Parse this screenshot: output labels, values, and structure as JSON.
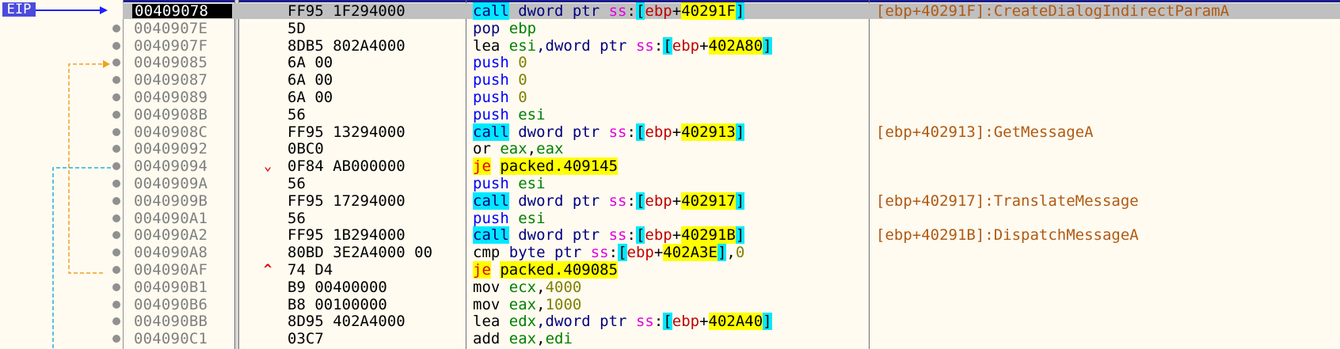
{
  "eip_label": "EIP",
  "rows": [
    {
      "addr": "00409078",
      "bytes": "FF95 1F294000",
      "instr": [
        {
          "t": "call",
          "c": "t-call"
        },
        {
          "t": " dword ptr ",
          "c": "t-kw"
        },
        {
          "t": "ss",
          "c": "t-seg"
        },
        {
          "t": ":",
          "c": ""
        },
        {
          "t": "[",
          "c": "t-br"
        },
        {
          "t": "ebp",
          "c": "t-red"
        },
        {
          "t": "+",
          "c": ""
        },
        {
          "t": "40291F",
          "c": "t-hl"
        },
        {
          "t": "]",
          "c": "t-br"
        }
      ],
      "comment": "[ebp+40291F]:CreateDialogIndirectParamA",
      "current": true
    },
    {
      "addr": "0040907E",
      "bytes": "5D",
      "instr": [
        {
          "t": "pop",
          "c": "t-mn"
        },
        {
          "t": " ",
          "c": ""
        },
        {
          "t": "ebp",
          "c": "t-reg"
        }
      ],
      "comment": ""
    },
    {
      "addr": "0040907F",
      "bytes": "8DB5 802A4000",
      "instr": [
        {
          "t": "lea",
          "c": ""
        },
        {
          "t": " ",
          "c": ""
        },
        {
          "t": "esi",
          "c": "t-reg"
        },
        {
          "t": ",dword ptr ",
          "c": "t-kw"
        },
        {
          "t": "ss",
          "c": "t-seg"
        },
        {
          "t": ":",
          "c": ""
        },
        {
          "t": "[",
          "c": "t-br"
        },
        {
          "t": "ebp",
          "c": "t-red"
        },
        {
          "t": "+",
          "c": ""
        },
        {
          "t": "402A80",
          "c": "t-hl"
        },
        {
          "t": "]",
          "c": "t-br"
        }
      ],
      "comment": ""
    },
    {
      "addr": "00409085",
      "bytes": "6A 00",
      "instr": [
        {
          "t": "push",
          "c": "t-push"
        },
        {
          "t": " ",
          "c": ""
        },
        {
          "t": "0",
          "c": "t-num"
        }
      ],
      "comment": ""
    },
    {
      "addr": "00409087",
      "bytes": "6A 00",
      "instr": [
        {
          "t": "push",
          "c": "t-push"
        },
        {
          "t": " ",
          "c": ""
        },
        {
          "t": "0",
          "c": "t-num"
        }
      ],
      "comment": ""
    },
    {
      "addr": "00409089",
      "bytes": "6A 00",
      "instr": [
        {
          "t": "push",
          "c": "t-push"
        },
        {
          "t": " ",
          "c": ""
        },
        {
          "t": "0",
          "c": "t-num"
        }
      ],
      "comment": ""
    },
    {
      "addr": "0040908B",
      "bytes": "56",
      "instr": [
        {
          "t": "push",
          "c": "t-push"
        },
        {
          "t": " ",
          "c": ""
        },
        {
          "t": "esi",
          "c": "t-reg"
        }
      ],
      "comment": ""
    },
    {
      "addr": "0040908C",
      "bytes": "FF95 13294000",
      "instr": [
        {
          "t": "call",
          "c": "t-call"
        },
        {
          "t": " dword ptr ",
          "c": "t-kw"
        },
        {
          "t": "ss",
          "c": "t-seg"
        },
        {
          "t": ":",
          "c": ""
        },
        {
          "t": "[",
          "c": "t-br"
        },
        {
          "t": "ebp",
          "c": "t-red"
        },
        {
          "t": "+",
          "c": ""
        },
        {
          "t": "402913",
          "c": "t-hl"
        },
        {
          "t": "]",
          "c": "t-br"
        }
      ],
      "comment": "[ebp+402913]:GetMessageA"
    },
    {
      "addr": "00409092",
      "bytes": "0BC0",
      "instr": [
        {
          "t": "or",
          "c": ""
        },
        {
          "t": " ",
          "c": ""
        },
        {
          "t": "eax",
          "c": "t-reg"
        },
        {
          "t": ",",
          "c": ""
        },
        {
          "t": "eax",
          "c": "t-reg"
        }
      ],
      "comment": ""
    },
    {
      "addr": "00409094",
      "bytes": "0F84 AB000000",
      "instr": [
        {
          "t": "je",
          "c": "t-je"
        },
        {
          "t": " ",
          "c": ""
        },
        {
          "t": "packed.409145",
          "c": "t-hl"
        }
      ],
      "comment": "",
      "jump": "⌄"
    },
    {
      "addr": "0040909A",
      "bytes": "56",
      "instr": [
        {
          "t": "push",
          "c": "t-push"
        },
        {
          "t": " ",
          "c": ""
        },
        {
          "t": "esi",
          "c": "t-reg"
        }
      ],
      "comment": ""
    },
    {
      "addr": "0040909B",
      "bytes": "FF95 17294000",
      "instr": [
        {
          "t": "call",
          "c": "t-call"
        },
        {
          "t": " dword ptr ",
          "c": "t-kw"
        },
        {
          "t": "ss",
          "c": "t-seg"
        },
        {
          "t": ":",
          "c": ""
        },
        {
          "t": "[",
          "c": "t-br"
        },
        {
          "t": "ebp",
          "c": "t-red"
        },
        {
          "t": "+",
          "c": ""
        },
        {
          "t": "402917",
          "c": "t-hl"
        },
        {
          "t": "]",
          "c": "t-br"
        }
      ],
      "comment": "[ebp+402917]:TranslateMessage"
    },
    {
      "addr": "004090A1",
      "bytes": "56",
      "instr": [
        {
          "t": "push",
          "c": "t-push"
        },
        {
          "t": " ",
          "c": ""
        },
        {
          "t": "esi",
          "c": "t-reg"
        }
      ],
      "comment": ""
    },
    {
      "addr": "004090A2",
      "bytes": "FF95 1B294000",
      "instr": [
        {
          "t": "call",
          "c": "t-call"
        },
        {
          "t": " dword ptr ",
          "c": "t-kw"
        },
        {
          "t": "ss",
          "c": "t-seg"
        },
        {
          "t": ":",
          "c": ""
        },
        {
          "t": "[",
          "c": "t-br"
        },
        {
          "t": "ebp",
          "c": "t-red"
        },
        {
          "t": "+",
          "c": ""
        },
        {
          "t": "40291B",
          "c": "t-hl"
        },
        {
          "t": "]",
          "c": "t-br"
        }
      ],
      "comment": "[ebp+40291B]:DispatchMessageA"
    },
    {
      "addr": "004090A8",
      "bytes": "80BD 3E2A4000 00",
      "instr": [
        {
          "t": "cmp",
          "c": ""
        },
        {
          "t": " byte ptr ",
          "c": "t-kw"
        },
        {
          "t": "ss",
          "c": "t-seg"
        },
        {
          "t": ":",
          "c": ""
        },
        {
          "t": "[",
          "c": "t-br"
        },
        {
          "t": "ebp",
          "c": "t-red"
        },
        {
          "t": "+",
          "c": ""
        },
        {
          "t": "402A3E",
          "c": "t-hl"
        },
        {
          "t": "]",
          "c": "t-br"
        },
        {
          "t": ",",
          "c": ""
        },
        {
          "t": "0",
          "c": "t-num"
        }
      ],
      "comment": ""
    },
    {
      "addr": "004090AF",
      "bytes": "74 D4",
      "instr": [
        {
          "t": "je",
          "c": "t-je"
        },
        {
          "t": " ",
          "c": ""
        },
        {
          "t": "packed.409085",
          "c": "t-hl"
        }
      ],
      "comment": "",
      "jump": "^"
    },
    {
      "addr": "004090B1",
      "bytes": "B9 00400000",
      "instr": [
        {
          "t": "mov",
          "c": ""
        },
        {
          "t": " ",
          "c": ""
        },
        {
          "t": "ecx",
          "c": "t-reg"
        },
        {
          "t": ",",
          "c": ""
        },
        {
          "t": "4000",
          "c": "t-num"
        }
      ],
      "comment": ""
    },
    {
      "addr": "004090B6",
      "bytes": "B8 00100000",
      "instr": [
        {
          "t": "mov",
          "c": ""
        },
        {
          "t": " ",
          "c": ""
        },
        {
          "t": "eax",
          "c": "t-reg"
        },
        {
          "t": ",",
          "c": ""
        },
        {
          "t": "1000",
          "c": "t-num"
        }
      ],
      "comment": ""
    },
    {
      "addr": "004090BB",
      "bytes": "8D95 402A4000",
      "instr": [
        {
          "t": "lea",
          "c": ""
        },
        {
          "t": " ",
          "c": ""
        },
        {
          "t": "edx",
          "c": "t-reg"
        },
        {
          "t": ",dword ptr ",
          "c": "t-kw"
        },
        {
          "t": "ss",
          "c": "t-seg"
        },
        {
          "t": ":",
          "c": ""
        },
        {
          "t": "[",
          "c": "t-br"
        },
        {
          "t": "ebp",
          "c": "t-red"
        },
        {
          "t": "+",
          "c": ""
        },
        {
          "t": "402A40",
          "c": "t-hl"
        },
        {
          "t": "]",
          "c": "t-br"
        }
      ],
      "comment": ""
    },
    {
      "addr": "004090C1",
      "bytes": "03C7",
      "instr": [
        {
          "t": "add",
          "c": ""
        },
        {
          "t": " ",
          "c": ""
        },
        {
          "t": "eax",
          "c": "t-reg"
        },
        {
          "t": ",",
          "c": ""
        },
        {
          "t": "edi",
          "c": "t-reg"
        }
      ],
      "comment": ""
    }
  ]
}
